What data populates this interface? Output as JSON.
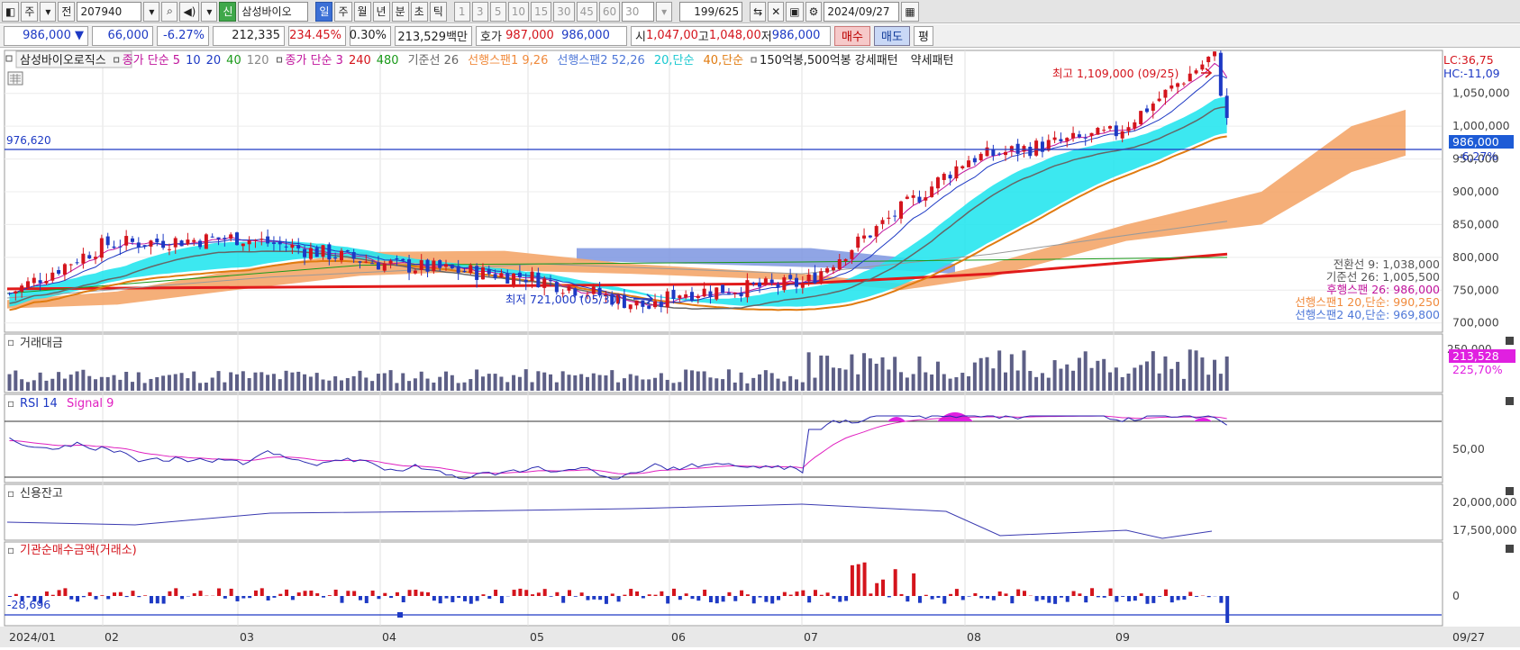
{
  "toolbar": {
    "period_label": "주",
    "prev_label": "전",
    "code": "207940",
    "stock_badge": "신",
    "stock_name": "삼성바이오",
    "timeframes": [
      "일",
      "주",
      "월",
      "년",
      "분",
      "초",
      "틱"
    ],
    "active_timeframe": "일",
    "intervals": [
      "1",
      "3",
      "5",
      "10",
      "15",
      "30",
      "45",
      "60"
    ],
    "interval_input": "30",
    "count": "199",
    "count_total": "/625",
    "date": "2024/09/27"
  },
  "quote": {
    "price": "986,000",
    "direction": "▼",
    "change": "66,000",
    "change_pct": "-6.27%",
    "volume": "212,335",
    "volume_ratio": "234.45%",
    "turnover_pct": "0.30%",
    "amount": "213,529백만",
    "ask_label": "호가",
    "ask": "987,000",
    "bid": "986,000",
    "open_label": "시",
    "open": "1,047,00",
    "high_label": "고",
    "high": "1,048,00",
    "low_label": "저",
    "low": "986,000",
    "buy_label": "매수",
    "sell_label": "매도",
    "eval_label": "평"
  },
  "legend": {
    "items": [
      {
        "text": "삼성바이오로직스",
        "color": "#222222"
      },
      {
        "text": "종가 단순 5",
        "color": "#c0139c"
      },
      {
        "text": "10",
        "color": "#1d39c4"
      },
      {
        "text": "20",
        "color": "#1d39c4"
      },
      {
        "text": "40",
        "color": "#1a9a1a"
      },
      {
        "text": "120",
        "color": "#888888"
      },
      {
        "text": "종가 단순 3",
        "color": "#c0139c"
      },
      {
        "text": "240",
        "color": "#d4141c"
      },
      {
        "text": "480",
        "color": "#1a9a1a"
      },
      {
        "text": "기준선 26",
        "color": "#666666"
      },
      {
        "text": "선행스팬1 9,26",
        "color": "#f08a3c"
      },
      {
        "text": "선행스팬2 52,26",
        "color": "#4f78d8"
      },
      {
        "text": "20,단순",
        "color": "#18c8d0"
      },
      {
        "text": "40,단순",
        "color": "#e07b10"
      },
      {
        "text": "150억봉,500억봉 강세패턴",
        "color": "#222222"
      },
      {
        "text": "약세패턴",
        "color": "#222222"
      }
    ]
  },
  "main_panel": {
    "lc": "LC:36,75",
    "hc": "HC:-11,09",
    "high_annot": "최고 1,109,000 (09/25)",
    "low_annot": "최저 721,000 (05/30)",
    "hline_value": "976,620",
    "price_tag": "986,000",
    "price_tag_pct": "-6,27%",
    "y_labels": [
      "1,050,000",
      "1,000,000",
      "950,000",
      "900,000",
      "850,000",
      "800,000",
      "750,000",
      "700,000"
    ],
    "side_info": [
      {
        "text": "전환선 9: 1,038,000",
        "color": "#555555"
      },
      {
        "text": "기준선 26: 1,005,500",
        "color": "#555555"
      },
      {
        "text": "후행스팬 26: 986,000",
        "color": "#c0139c"
      },
      {
        "text": "선행스팬1 20,단순: 990,250",
        "color": "#f08a3c"
      },
      {
        "text": "선행스팬2 40,단순: 969,800",
        "color": "#4f78d8"
      }
    ]
  },
  "volume_panel": {
    "title": "거래대금",
    "y_label": "250,000",
    "tag_value": "213,528",
    "tag_pct": "225,70%"
  },
  "rsi_panel": {
    "title": "RSI 14",
    "signal": "Signal 9",
    "y_label": "50,00"
  },
  "credit_panel": {
    "title": "신용잔고",
    "y_labels": [
      "20,000,000",
      "17,500,000"
    ]
  },
  "inst_panel": {
    "title": "기관순매수금액(거래소)",
    "value": "-28,696",
    "y_label": "0"
  },
  "x_axis": {
    "labels": [
      "2024/01",
      "02",
      "03",
      "04",
      "05",
      "06",
      "07",
      "08",
      "09"
    ],
    "right_label": "09/27"
  },
  "colors": {
    "up": "#d4141c",
    "down": "#1d39c4",
    "accent": "#3b6fd6",
    "cloud_bull": "#f4a66a",
    "cloud_bear": "#7c95e0",
    "band_cyan": "#27e6ee",
    "volume_bar": "#5d5f86",
    "rsi_line": "#2a2ab0",
    "signal_line": "#e020c0",
    "overbought": "#e020e0"
  },
  "chart_data": {
    "type": "candlestick",
    "x_range": [
      "2024/01",
      "2024/09/27"
    ],
    "y_range": [
      690000,
      1110000
    ],
    "close_series_approx": [
      {
        "date": "2024/01",
        "value": 745000
      },
      {
        "date": "2024/02",
        "value": 820000
      },
      {
        "date": "2024/03",
        "value": 830000
      },
      {
        "date": "2024/04",
        "value": 790000
      },
      {
        "date": "2024/05",
        "value": 770000
      },
      {
        "date": "2024/05/30",
        "value": 721000
      },
      {
        "date": "2024/06",
        "value": 745000
      },
      {
        "date": "2024/07",
        "value": 760000
      },
      {
        "date": "2024/08",
        "value": 950000
      },
      {
        "date": "2024/09",
        "value": 990000
      },
      {
        "date": "2024/09/25",
        "value": 1109000
      },
      {
        "date": "2024/09/27",
        "value": 986000
      }
    ]
  }
}
